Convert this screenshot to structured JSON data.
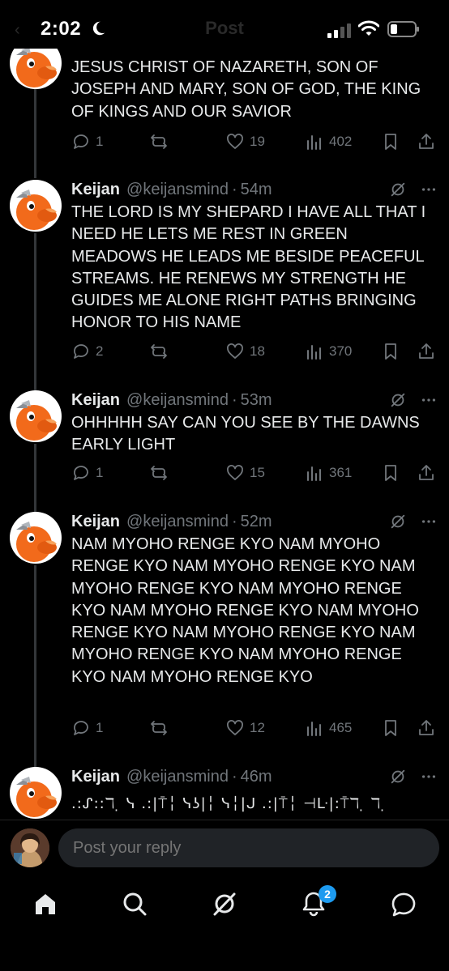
{
  "status_bar": {
    "time": "2:02",
    "nav_title": "Post"
  },
  "posts": [
    {
      "text": "JESUS CHRIST OF NAZARETH, SON OF JOSEPH AND MARY, SON OF GOD, THE KING OF KINGS AND OUR SAVIOR",
      "replies": "1",
      "likes": "19",
      "views": "402"
    },
    {
      "name": "Keijan",
      "handle": "@keijansmind",
      "time": "54m",
      "text": "THE LORD IS MY SHEPARD I HAVE ALL THAT I NEED HE LETS ME REST IN GREEN MEADOWS HE LEADS ME BESIDE PEACEFUL STREAMS. HE RENEWS MY STRENGTH HE GUIDES ME ALONE RIGHT PATHS BRINGING HONOR TO HIS NAME",
      "replies": "2",
      "likes": "18",
      "views": "370"
    },
    {
      "name": "Keijan",
      "handle": "@keijansmind",
      "time": "53m",
      "text": "OHHHHH SAY CAN YOU SEE BY THE DAWNS EARLY LIGHT",
      "replies": "1",
      "likes": "15",
      "views": "361"
    },
    {
      "name": "Keijan",
      "handle": "@keijansmind",
      "time": "52m",
      "text": "NAM MYOHO RENGE KYO NAM MYOHO RENGE KYO NAM MYOHO RENGE KYO NAM MYOHO RENGE KYO NAM MYOHO RENGE KYO NAM MYOHO RENGE KYO NAM MYOHO RENGE KYO NAM MYOHO RENGE KYO NAM MYOHO RENGE KYO NAM MYOHO RENGE KYO NAM MYOHO RENGE KYO",
      "replies": "1",
      "likes": "12",
      "views": "465"
    },
    {
      "name": "Keijan",
      "handle": "@keijansmind",
      "time": "46m",
      "text": ".:ᔑ::ℸ ̣ ᓭ .:|⍑╎ ᓭʖ|╎ ᓭ╎|ᒍ .:|⍑╎ ⊣ᒷ|:⍑ℸ ̣ ℸ ̣"
    }
  ],
  "reply_bar": {
    "placeholder": "Post your reply"
  },
  "tab_bar": {
    "notifications_badge": "2"
  },
  "colors": {
    "accent": "#1d9bf0",
    "muted": "#71767b",
    "text": "#e7e9ea",
    "background": "#000000"
  }
}
